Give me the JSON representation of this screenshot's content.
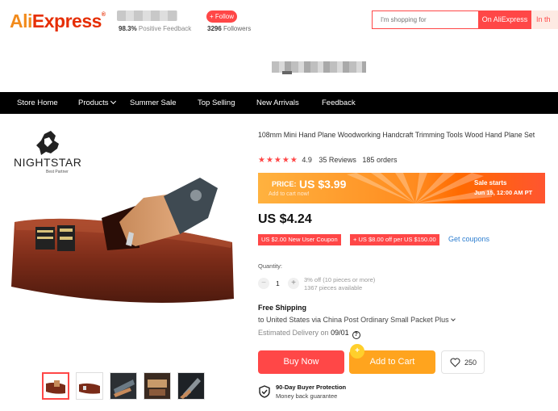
{
  "header": {
    "logo_part1": "Ali",
    "logo_part2": "Express",
    "logo_tm": "®",
    "feedback_value": "98.3%",
    "feedback_label": "Positive Feedback",
    "follow_label": "+ Follow",
    "followers_count": "3296",
    "followers_label": "Followers",
    "search_placeholder": "I'm shopping for",
    "search_on_ali": "On AliExpress",
    "search_in_store": "In th"
  },
  "nav": {
    "items": [
      "Store Home",
      "Products",
      "Summer Sale",
      "Top Selling",
      "New Arrivals",
      "Feedback"
    ]
  },
  "brand": {
    "name": "NIGHTSTAR",
    "tagline": "Best Partner"
  },
  "product": {
    "title": "108mm Mini Hand Plane Woodworking Handcraft Trimming Tools Wood Hand Plane Set",
    "stars": "★★★★★",
    "rating": "4.9",
    "rating_caret": "⌄",
    "reviews": "35 Reviews",
    "orders": "185 orders",
    "promo": {
      "price_label": "PRICE:",
      "price_value": "US $3.99",
      "cart_now": "Add to cart now!",
      "sale_starts": "Sale starts",
      "sale_date": "Jun 15, 12:00 AM PT"
    },
    "price": "US $4.24",
    "coupons": [
      "US $2.00 New User Coupon",
      "+ US $8.00 off per US $150.00"
    ],
    "get_coupons": "Get coupons",
    "quantity": {
      "label": "Quantity:",
      "minus": "−",
      "value": "1",
      "plus": "+",
      "discount_note": "3% off (10 pieces or more)",
      "available": "1367 pieces available"
    },
    "shipping": {
      "title": "Free Shipping",
      "route": "to United States via China Post Ordinary Small Packet Plus",
      "est_label": "Estimated Delivery on",
      "est_date": "09/01",
      "help": "?"
    },
    "actions": {
      "buy_now": "Buy Now",
      "add_to_cart": "Add to Cart",
      "cart_badge": "+",
      "wishlist_count": "250"
    },
    "protection": {
      "title": "90-Day Buyer Protection",
      "subtitle": "Money back guarantee"
    }
  },
  "colors": {
    "brand_red": "#ff4747",
    "brand_orange": "#ffa41e",
    "nav_bg": "#000000",
    "link_blue": "#2d7ed0"
  },
  "icons": [
    "chevron-down-icon",
    "star-icon",
    "help-icon",
    "heart-icon",
    "shield-check-icon",
    "plus-icon",
    "minus-icon"
  ]
}
